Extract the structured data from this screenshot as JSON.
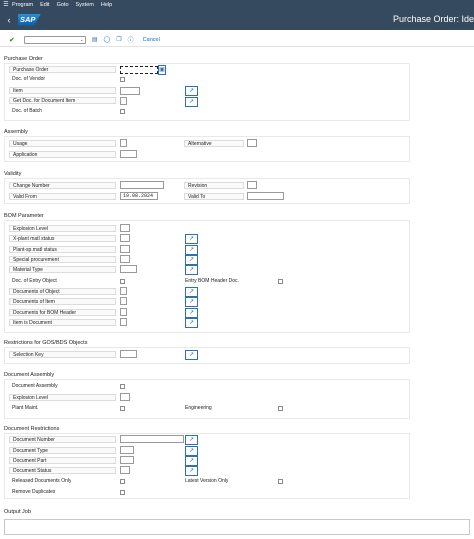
{
  "menu": {
    "items": [
      "Program",
      "Edit",
      "Goto",
      "System",
      "Help"
    ]
  },
  "titlebar": {
    "logo": "SAP",
    "title": "Purchase Order: Ide"
  },
  "toolbar": {
    "cancel": "Cancel",
    "command_value": ""
  },
  "sections": {
    "purchase_order": {
      "title": "Purchase Order",
      "purchase_order_label": "Purchase Order",
      "doc_of_vendor": "Doc. of Vendor",
      "item": "Item",
      "get_doc": "Get Doc. for Document Item",
      "doc_of_batch": "Doc. of Batch"
    },
    "assembly": {
      "title": "Assembly",
      "usage": "Usage",
      "alternative": "Alternative",
      "application": "Application"
    },
    "validity": {
      "title": "Validity",
      "change_number": "Change Number",
      "revision": "Revision",
      "valid_from": "Valid From",
      "valid_from_value": "19.08.2024",
      "valid_to": "Valid To"
    },
    "bom": {
      "title": "BOM Parameter",
      "explosion_level": "Explosion Level",
      "x_plant": "X-plant matl status",
      "plant_sp": "Plant-sp.matl status",
      "special": "Special procurement",
      "material_type": "Material Type",
      "doc_entry_object": "Doc. of Entry Object",
      "entry_bom_header": "Entry BOM Header Doc.",
      "docs_object": "Documents of Object",
      "docs_item": "Documents of Item",
      "docs_bom_header": "Documents for BOM Header",
      "item_is_document": "Item is Document"
    },
    "gos": {
      "title": "Restrictions for GOS/BDS Objects",
      "selection_key": "Selection Key"
    },
    "doc_assembly": {
      "title": "Document Assembly",
      "document_assembly": "Document Assembly",
      "explosion_level": "Explosion Level",
      "plant_maint": "Plant Maint.",
      "engineering": "Engineering"
    },
    "doc_restrictions": {
      "title": "Document Restrictions",
      "document_number": "Document Number",
      "document_type": "Document Type",
      "document_part": "Document Part",
      "document_status": "Document Status",
      "released_only": "Released Documents Only",
      "latest_only": "Latest Version Only",
      "remove_duplicates": "Remove Duplicates"
    },
    "output": {
      "title": "Output Job"
    }
  }
}
